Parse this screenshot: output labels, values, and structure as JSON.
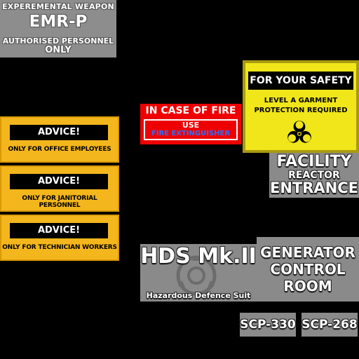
{
  "emr_sign": {
    "line1": "EXPEREMENTAL WEAPON",
    "line2": "EMR-P",
    "line3": "AUTHORISED PERSONNEL",
    "line4": "ONLY"
  },
  "advice_signs": [
    {
      "heading": "ADVICE!",
      "text": "ONLY FOR OFFICE EMPLOYEES"
    },
    {
      "heading": "ADVICE!",
      "text": "ONLY FOR JANITORIAL PERSONNEL"
    },
    {
      "heading": "ADVICE!",
      "text": "ONLY FOR TECHNICIAN WORKERS"
    }
  ],
  "fire_sign": {
    "line1": "IN CASE OF FIRE",
    "line2": "USE",
    "line3": "FIRE EXTINGUISHER"
  },
  "safety_sign": {
    "heading": "FOR YOUR SAFETY",
    "line1": "LEVEL A GARMENT",
    "line2": "PROTECTION REQUIRED",
    "icon": "biohazard-icon"
  },
  "facility_sign": {
    "line1": "FACILITY",
    "line2": "REACTOR",
    "line3": "ENTRANCE"
  },
  "hds_sign": {
    "title": "HDS Mk.II",
    "subtitle": "Hazardous Defence Suit",
    "icon": "scp-logo-icon"
  },
  "generator_sign": {
    "line1": "GENERATOR",
    "line2": "CONTROL",
    "line3": "ROOM"
  },
  "scp_labels": [
    "SCP-330",
    "SCP-268"
  ],
  "colors": {
    "background": "#000000",
    "gray_panel": "#8a8a8a",
    "advice_yellow": "#f3b61c",
    "fire_red": "#ee0000",
    "extinguisher_blue": "#2a6fff",
    "safety_yellow": "#f0e61a"
  }
}
